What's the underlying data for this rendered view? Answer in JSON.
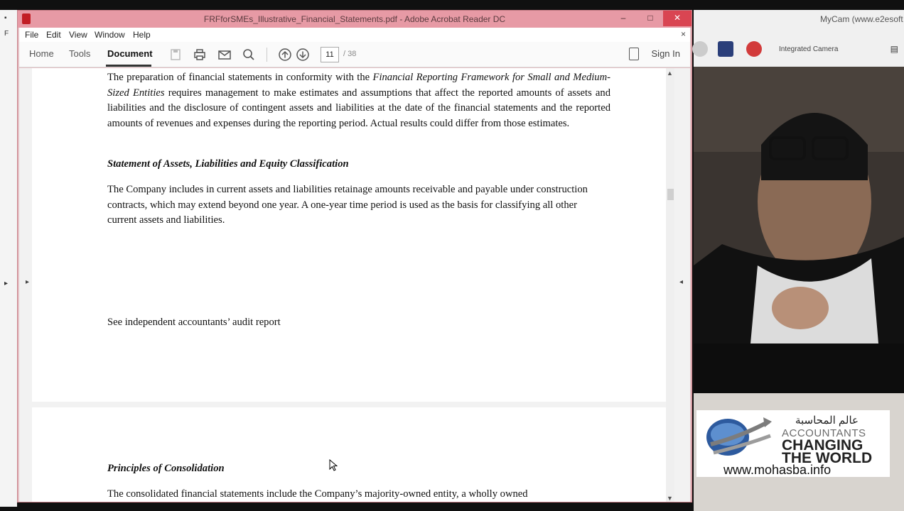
{
  "acrobat": {
    "title": "FRFforSMEs_Illustrative_Financial_Statements.pdf - Adobe Acrobat Reader DC",
    "menu": [
      "File",
      "Edit",
      "View",
      "Window",
      "Help"
    ],
    "tabs": {
      "home": "Home",
      "tools": "Tools",
      "document": "Document"
    },
    "page_current": "11",
    "page_total": "/ 38",
    "sign_in": "Sign In"
  },
  "document": {
    "para1_pre": "The preparation of financial statements in conformity with the ",
    "para1_ital": "Financial Reporting Framework for Small and Medium-Sized Entities",
    "para1_post": " requires management to make estimates and assumptions that affect the reported amounts of assets and liabilities and the disclosure of contingent assets and liabilities at the date of the financial statements and the reported amounts of revenues and expenses during the reporting period. Actual results could differ from those estimates.",
    "heading1": "Statement of Assets, Liabilities and Equity Classification",
    "para2": "The Company includes in current assets and liabilities retainage amounts receivable and payable under construction contracts, which may extend beyond one year. A one-year time period is used as the basis for classifying all other current assets and liabilities.",
    "footer_note": "See independent accountants’ audit report",
    "heading2": "Principles of Consolidation",
    "para3_partial": "The consolidated financial statements include the Company’s majority-owned entity, a wholly owned"
  },
  "mycam": {
    "title": "MyCam (www.e2esoft",
    "device": "Integrated Camera"
  },
  "logo": {
    "arabic": "عالم المحاسبة",
    "line1": "ACCOUNTANTS",
    "line2": "CHANGING",
    "line3": "THE WORLD",
    "url": "www.mohasba.info"
  }
}
